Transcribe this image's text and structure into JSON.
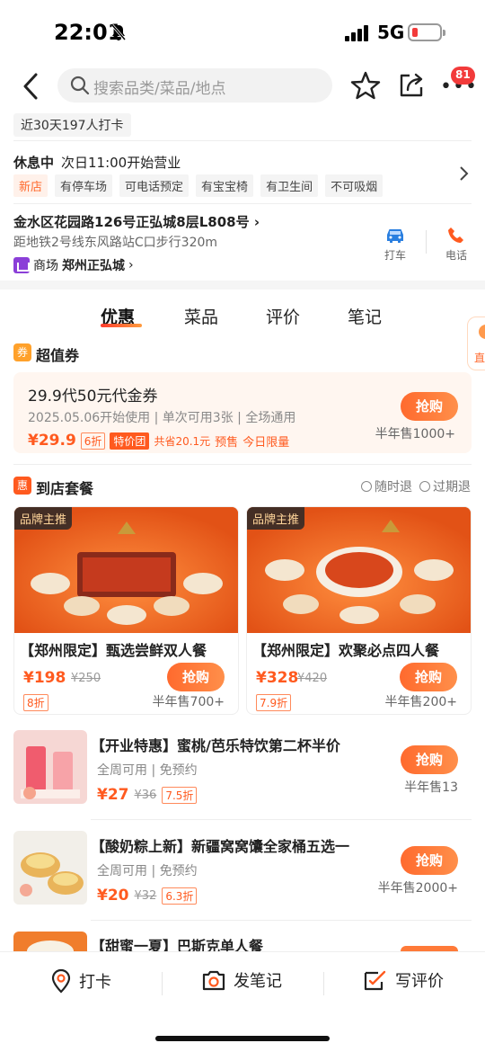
{
  "status_bar": {
    "time": "22:01",
    "network": "5G"
  },
  "nav": {
    "search_placeholder": "搜索品类/菜品/地点",
    "more_badge": "81"
  },
  "checkin_summary": "近30天197人打卡",
  "hours": {
    "status": "休息中",
    "next_open": "次日11:00开始营业",
    "tags": [
      "新店",
      "有停车场",
      "可电话预定",
      "有宝宝椅",
      "有卫生间",
      "不可吸烟"
    ]
  },
  "address": {
    "line": "金水区花园路126号正弘城8层L808号",
    "subway": "距地铁2号线东风路站C口步行320m",
    "mall_label": "商场",
    "mall_name": "郑州正弘城",
    "taxi_label": "打车",
    "phone_label": "电话"
  },
  "tabs": [
    "优惠",
    "菜品",
    "评价",
    "笔记"
  ],
  "side_float_label": "直",
  "coupon_section": {
    "icon_text": "券",
    "title": "超值券",
    "coupon": {
      "title": "29.9代50元代金券",
      "usage": "2025.05.06开始使用",
      "per_order": "单次可用3张",
      "scope": "全场通用",
      "price": "¥29.9",
      "discount": "6折",
      "group_tag": "特价团",
      "saving": "共省20.1元",
      "presale": "预售",
      "limit": "今日限量",
      "buy_label": "抢购",
      "sold": "半年售1000+"
    }
  },
  "set_section": {
    "icon_text": "惠",
    "title": "到店套餐",
    "policy_1": "随时退",
    "policy_2": "过期退",
    "cards": [
      {
        "badge": "品牌主推",
        "name": "【郑州限定】甄选尝鲜双人餐",
        "price": "¥198",
        "original": "¥250",
        "discount": "8折",
        "buy_label": "抢购",
        "sold": "半年售700+"
      },
      {
        "badge": "品牌主推",
        "name": "【郑州限定】欢聚必点四人餐",
        "price": "¥328",
        "original": "¥420",
        "discount": "7.9折",
        "buy_label": "抢购",
        "sold": "半年售200+"
      }
    ],
    "items": [
      {
        "title": "【开业特惠】蜜桃/芭乐特饮第二杯半价",
        "sub": "全周可用 | 免预约",
        "price": "¥27",
        "original": "¥36",
        "discount": "7.5折",
        "buy_label": "抢购",
        "sold": "半年售13"
      },
      {
        "title": "【酸奶粽上新】新疆窝窝馕全家桶五选一",
        "sub": "全周可用 | 免预约",
        "price": "¥20",
        "original": "¥32",
        "discount": "6.3折",
        "buy_label": "抢购",
        "sold": "半年售2000+"
      },
      {
        "title": "【甜蜜一夏】巴斯克单人餐"
      }
    ]
  },
  "bottom_bar": {
    "checkin": "打卡",
    "note": "发笔记",
    "review": "写评价"
  },
  "colors": {
    "accent": "#ff5a1f",
    "badge_red": "#f23b3b",
    "coupon_bg": "#fff6f0"
  }
}
